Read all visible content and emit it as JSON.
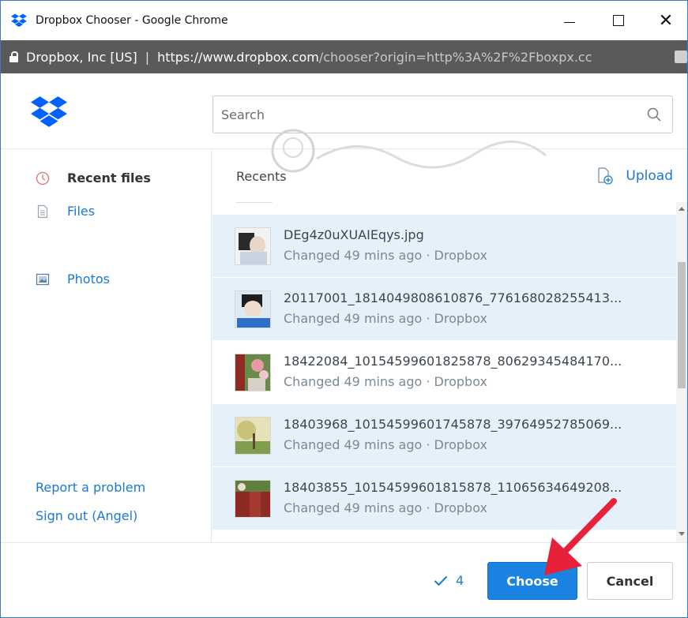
{
  "window": {
    "title": "Dropbox Chooser - Google Chrome",
    "app_icon": "dropbox-icon"
  },
  "address_bar": {
    "owner": "Dropbox, Inc [US]",
    "separator": "|",
    "host": "https://www.dropbox.com",
    "path": "/chooser?origin=http%3A%2F%2Fboxpx.cc"
  },
  "search": {
    "placeholder": "Search"
  },
  "sidebar": {
    "items": [
      {
        "label": "Recent files",
        "icon": "clock-icon",
        "active": true
      },
      {
        "label": "Files",
        "icon": "file-icon",
        "active": false
      },
      {
        "label": "Photos",
        "icon": "photo-icon",
        "active": false
      }
    ],
    "links": [
      {
        "label": "Report a problem"
      },
      {
        "label": "Sign out (Angel)"
      }
    ]
  },
  "main": {
    "section_label": "Recents",
    "upload_label": "Upload"
  },
  "files": [
    {
      "name": "DEg4z0uXUAIEqys.jpg",
      "meta": "Changed 49 mins ago · Dropbox",
      "selected": true
    },
    {
      "name": "20117001_1814049808610876_776168028255413...",
      "meta": "Changed 49 mins ago · Dropbox",
      "selected": true
    },
    {
      "name": "18422084_10154599601825878_80629345484170...",
      "meta": "Changed 49 mins ago · Dropbox",
      "selected": false
    },
    {
      "name": "18403968_10154599601745878_39764952785069...",
      "meta": "Changed 49 mins ago · Dropbox",
      "selected": true
    },
    {
      "name": "18403855_10154599601815878_11065634649208...",
      "meta": "Changed 49 mins ago · Dropbox",
      "selected": true
    }
  ],
  "footer": {
    "selected_count": "4",
    "choose_label": "Choose",
    "cancel_label": "Cancel"
  },
  "colors": {
    "accent": "#1a82e0",
    "selected_row": "#e4f1fb",
    "arrow": "#e8213b"
  }
}
